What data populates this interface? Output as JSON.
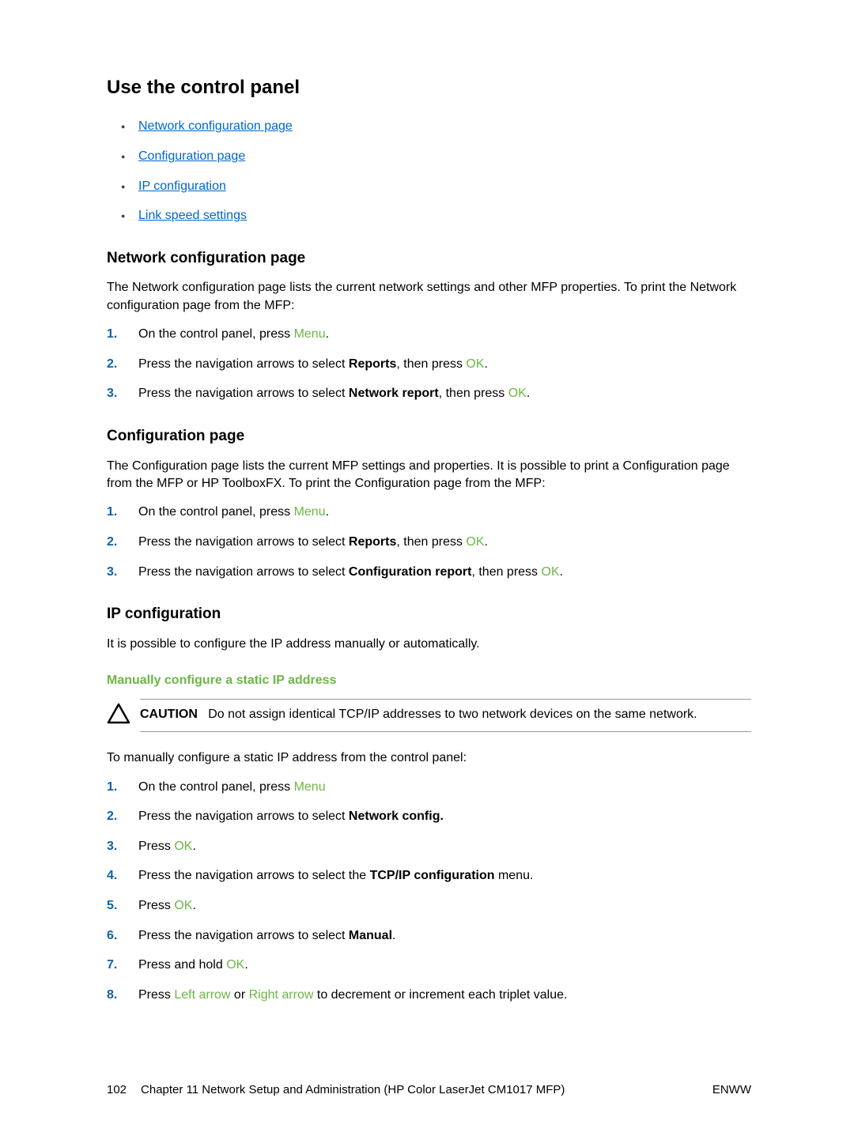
{
  "title": "Use the control panel",
  "links": [
    "Network configuration page",
    "Configuration page",
    "IP configuration",
    "Link speed settings"
  ],
  "section1": {
    "heading": "Network configuration page",
    "intro": "The Network configuration page lists the current network settings and other MFP properties. To print the Network configuration page from the MFP:",
    "steps": [
      {
        "pre": "On the control panel, press ",
        "green": "Menu",
        "post": "."
      },
      {
        "pre": "Press the navigation arrows to select ",
        "bold": "Reports",
        "post1": ", then press ",
        "green": "OK",
        "post2": "."
      },
      {
        "pre": "Press the navigation arrows to select ",
        "bold": "Network report",
        "post1": ", then press ",
        "green": "OK",
        "post2": "."
      }
    ]
  },
  "section2": {
    "heading": "Configuration page",
    "intro": "The Configuration page lists the current MFP settings and properties. It is possible to print a Configuration page from the MFP or HP ToolboxFX. To print the Configuration page from the MFP:",
    "steps": [
      {
        "pre": "On the control panel, press ",
        "green": "Menu",
        "post": "."
      },
      {
        "pre": "Press the navigation arrows to select ",
        "bold": "Reports",
        "post1": ", then press ",
        "green": "OK",
        "post2": "."
      },
      {
        "pre": "Press the navigation arrows to select ",
        "bold": "Configuration report",
        "post1": ", then press ",
        "green": "OK",
        "post2": "."
      }
    ]
  },
  "section3": {
    "heading": "IP configuration",
    "intro": "It is possible to configure the IP address manually or automatically.",
    "subheading": "Manually configure a static IP address",
    "caution_label": "CAUTION",
    "caution_text": "Do not assign identical TCP/IP addresses to two network devices on the same network.",
    "lead": "To manually configure a static IP address from the control panel:",
    "steps": {
      "s1_pre": "On the control panel, press ",
      "s1_green": "Menu",
      "s2_pre": "Press the navigation arrows to select ",
      "s2_bold": "Network config.",
      "s3_pre": "Press ",
      "s3_green": "OK",
      "s3_post": ".",
      "s4_pre": "Press the navigation arrows to select the ",
      "s4_bold": "TCP/IP configuration",
      "s4_post": " menu.",
      "s5_pre": "Press ",
      "s5_green": "OK",
      "s5_post": ".",
      "s6_pre": "Press the navigation arrows to select ",
      "s6_bold": "Manual",
      "s6_post": ".",
      "s7_pre": "Press and hold ",
      "s7_green": "OK",
      "s7_post": ".",
      "s8_pre": "Press ",
      "s8_g1": "Left arrow",
      "s8_mid": " or ",
      "s8_g2": "Right arrow",
      "s8_post": " to decrement or increment each triplet value."
    }
  },
  "footer": {
    "page": "102",
    "chapter": "Chapter 11   Network Setup and Administration (HP Color LaserJet CM1017 MFP)",
    "right": "ENWW"
  }
}
